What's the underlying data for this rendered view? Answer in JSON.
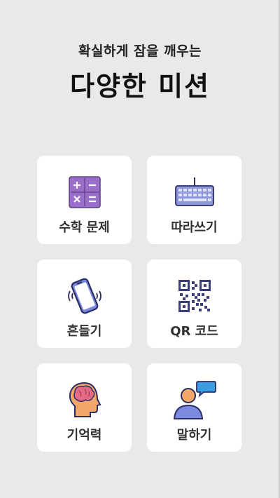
{
  "header": {
    "subtitle": "확실하게 잠을 깨우는",
    "title": "다양한 미션"
  },
  "missions": [
    {
      "label": "수학 문제",
      "icon": "calculator-icon"
    },
    {
      "label": "따라쓰기",
      "icon": "keyboard-icon"
    },
    {
      "label": "흔들기",
      "icon": "shaking-phone-icon"
    },
    {
      "label": "QR 코드",
      "icon": "qr-code-icon"
    },
    {
      "label": "기억력",
      "icon": "brain-head-icon"
    },
    {
      "label": "말하기",
      "icon": "speaking-person-icon"
    }
  ],
  "colors": {
    "background": "#e9e9e9",
    "card": "#ffffff",
    "purple": "#9b6fc9",
    "keyboard_blue": "#8e96dc",
    "phone_outline": "#2b2e63",
    "qr_dark": "#3a3f7a",
    "head_orange": "#f4a76b",
    "brain_pink": "#e56a86",
    "speech_blue": "#3d9be0"
  }
}
